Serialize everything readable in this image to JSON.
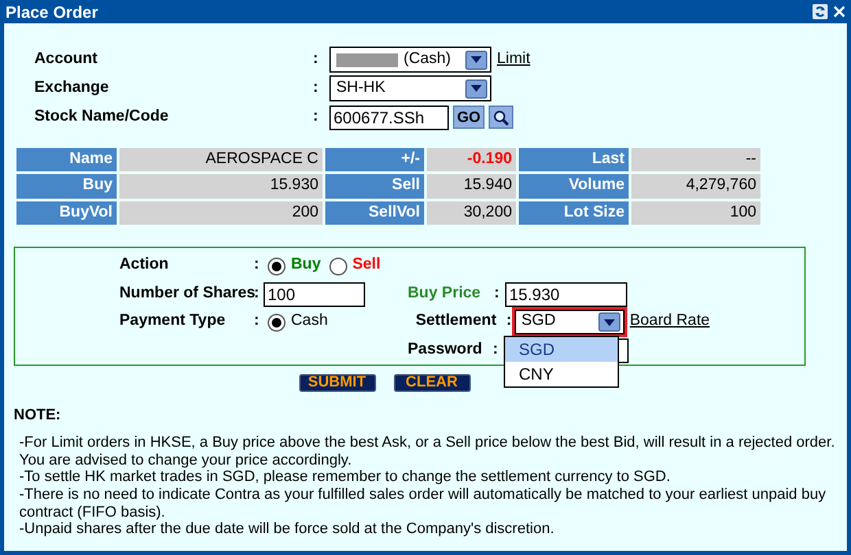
{
  "window": {
    "title": "Place Order"
  },
  "top_form": [
    {
      "label": "Account",
      "sep": ":",
      "kind": "select",
      "value": "(Cash)",
      "redacted": true,
      "link": "Limit"
    },
    {
      "label": "Exchange",
      "sep": ":",
      "kind": "select",
      "value": "SH-HK"
    },
    {
      "label": "Stock Name/Code",
      "sep": ":",
      "kind": "lookup",
      "value": "600677.SSh",
      "button": "GO"
    }
  ],
  "quote": [
    [
      {
        "label": "Name",
        "value": "AEROSPACE C"
      },
      {
        "label": "+/-",
        "value": "-0.190",
        "color": "#ff0000"
      },
      {
        "label": "Last",
        "value": "--"
      }
    ],
    [
      {
        "label": "Buy",
        "value": "15.930"
      },
      {
        "label": "Sell",
        "value": "15.940"
      },
      {
        "label": "Volume",
        "value": "4,279,760"
      }
    ],
    [
      {
        "label": "BuyVol",
        "value": "200"
      },
      {
        "label": "SellVol",
        "value": "30,200"
      },
      {
        "label": "Lot Size",
        "value": "100"
      }
    ]
  ],
  "order": {
    "action": {
      "label": "Action",
      "sep": ":",
      "options": [
        {
          "label": "Buy",
          "selected": true,
          "color": "#008000"
        },
        {
          "label": "Sell",
          "selected": false,
          "color": "#ff0000"
        }
      ]
    },
    "shares": {
      "label": "Number of Shares",
      "sep": ":",
      "value": "100"
    },
    "price": {
      "label": "Buy Price",
      "sep": ":",
      "value": "15.930"
    },
    "payment": {
      "label": "Payment Type",
      "sep": ":",
      "options": [
        {
          "label": "Cash",
          "selected": true
        }
      ]
    },
    "settlement": {
      "label": "Settlement",
      "sep": ":",
      "value": "SGD",
      "highlighted": true,
      "link": "Board Rate",
      "expanded": true,
      "options": [
        {
          "label": "SGD",
          "selected": true
        },
        {
          "label": "CNY",
          "selected": false
        }
      ]
    },
    "password": {
      "label": "Password",
      "sep": ":"
    }
  },
  "buttons": [
    "SUBMIT",
    "CLEAR"
  ],
  "note": {
    "title": "NOTE:",
    "lines": [
      "-For Limit orders in HKSE, a Buy price above the best Ask, or a Sell price below the best Bid, will result in a rejected order. You are advised to change your price accordingly.",
      "-To settle HK market trades in SGD, please remember to change the settlement currency to SGD.",
      "-There is no need to indicate Contra as your fulfilled sales order will automatically be matched to your earliest unpaid buy contract (FIFO basis).",
      "-Unpaid shares after the due date will be force sold at the Company's discretion."
    ]
  }
}
